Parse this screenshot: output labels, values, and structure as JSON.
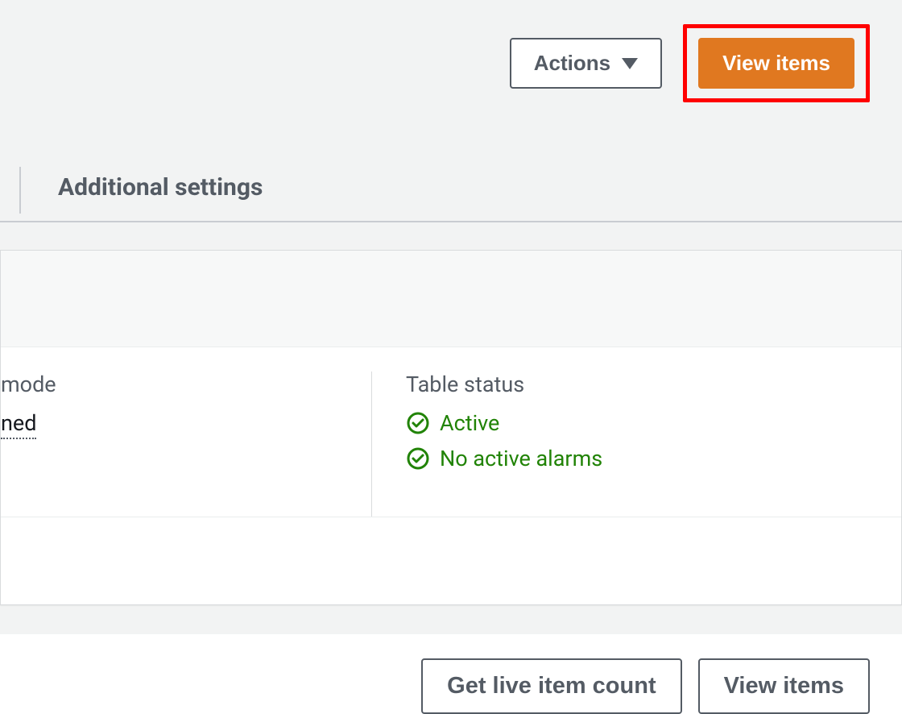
{
  "header": {
    "actions_label": "Actions",
    "view_items_label": "View items"
  },
  "tabs": {
    "additional_settings": "Additional settings"
  },
  "panel": {
    "left": {
      "label_suffix": " mode",
      "value_suffix": "ned"
    },
    "right": {
      "label": "Table status",
      "status_active": "Active",
      "status_alarms": "No active alarms"
    }
  },
  "bottom": {
    "get_live_count": "Get live item count",
    "view_items": "View items"
  }
}
